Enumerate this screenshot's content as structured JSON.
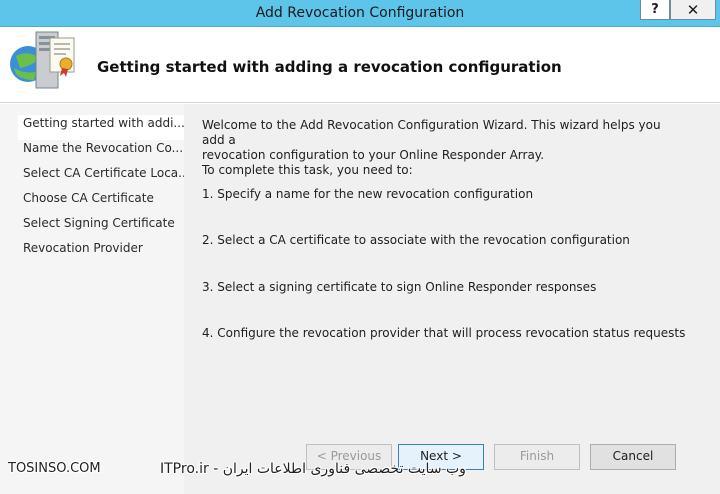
{
  "window": {
    "title": "Add Revocation Configuration",
    "help_label": "?",
    "close_label": "✕"
  },
  "header": {
    "title": "Getting started with adding a revocation configuration"
  },
  "steps": [
    {
      "label": "Getting started with addi..."
    },
    {
      "label": "Name the Revocation Co..."
    },
    {
      "label": "Select CA Certificate Loca..."
    },
    {
      "label": "Choose CA Certificate"
    },
    {
      "label": "Select Signing Certificate"
    },
    {
      "label": "Revocation Provider"
    }
  ],
  "content": {
    "intro_line1": "Welcome to the Add Revocation Configuration Wizard. This wizard helps you add a",
    "intro_line2": "revocation configuration to your Online Responder Array.",
    "intro_line3": "To complete this task, you need to:",
    "tasks": [
      {
        "text": "1. Specify a name for the new revocation configuration"
      },
      {
        "text": "2. Select a CA certificate to associate with the revocation configuration"
      },
      {
        "text": "3. Select a signing certificate to sign Online Responder responses"
      },
      {
        "text": "4. Configure the revocation provider that will process revocation status requests"
      }
    ]
  },
  "buttons": {
    "previous": "< Previous",
    "next": "Next >",
    "finish": "Finish",
    "cancel": "Cancel"
  },
  "watermark": {
    "left": "TOSINSO.COM",
    "right": "ITPro.ir - وب سایت تخصصی فناوری اطلاعات ایران"
  },
  "colors": {
    "titlebar": "#5cc5e9",
    "content_bg": "#f0f0f0",
    "sidebar_bg": "#f5f5f5"
  }
}
